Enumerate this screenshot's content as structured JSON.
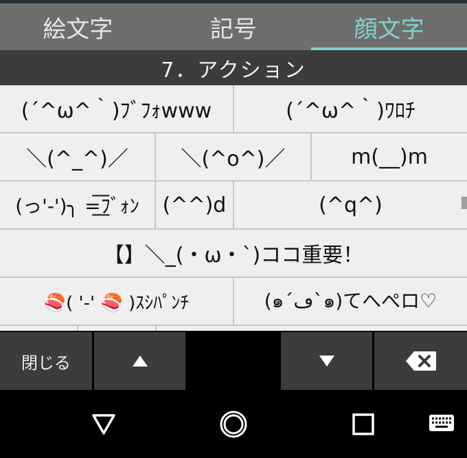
{
  "tabs": [
    {
      "label": "絵文字",
      "active": false
    },
    {
      "label": "記号",
      "active": false
    },
    {
      "label": "顔文字",
      "active": true
    }
  ],
  "category": "7．アクション",
  "rows": [
    [
      "(´^ω^｀)ﾌﾞﾌｫwww",
      "(´^ω^｀)ﾜﾛﾁ"
    ],
    [
      "＼(^_^)／",
      "＼(^o^)／",
      "m(__)m"
    ],
    [
      "(っ'-')╮ =͟͟͞͞ﾌﾞｫﾝ",
      "(^^)d",
      "(^q^)"
    ],
    [
      "【】＼_(・ω・`)ココ重要！"
    ],
    [
      "🍣( '-' 🍣 )ｽｼﾊﾟﾝﾁ",
      "(๑´ڡ`๑)てへぺロ♡"
    ]
  ],
  "keys": {
    "close_label": "閉じる",
    "up_icon": "triangle-up-icon",
    "down_icon": "triangle-down-icon",
    "backspace_icon": "backspace-icon"
  },
  "nav": {
    "back_icon": "back-triangle-icon",
    "home_icon": "home-circle-icon",
    "recents_icon": "recents-square-icon",
    "keyboard_icon": "keyboard-icon"
  },
  "colors": {
    "accent": "#7fd3cf",
    "tab_bg": "#6e6e6e",
    "category_bg": "#3c3c3c",
    "cell_bg": "#efefef",
    "key_bg": "#3c3c3c"
  }
}
